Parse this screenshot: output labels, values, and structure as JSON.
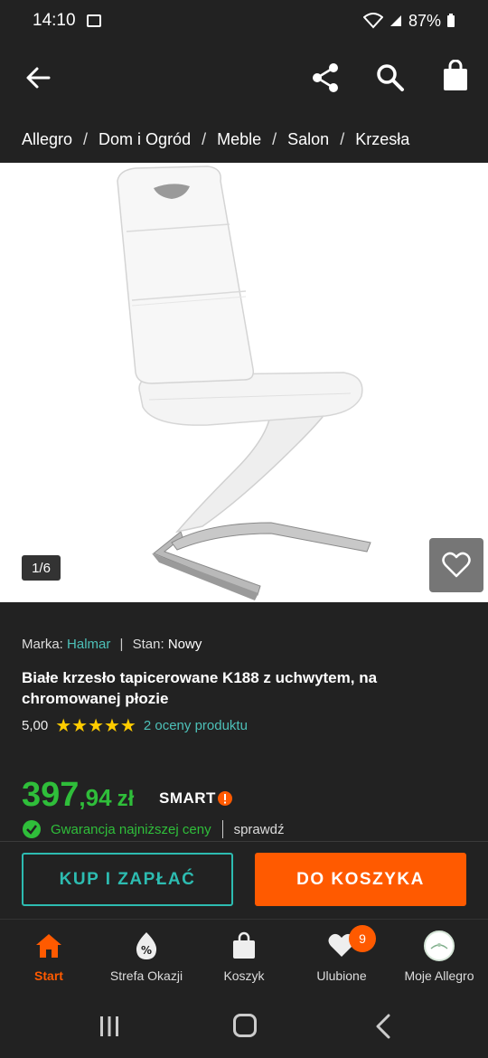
{
  "status_bar": {
    "time": "14:10",
    "battery": "87%"
  },
  "app_bar": {
    "icons": [
      "back-arrow-icon",
      "share-icon",
      "search-icon",
      "shopping-bag-icon"
    ]
  },
  "breadcrumb": [
    "Allegro",
    "Dom i Ogród",
    "Meble",
    "Salon",
    "Krzesła"
  ],
  "gallery": {
    "counter": "1/6"
  },
  "product": {
    "brand_label": "Marka:",
    "brand": "Halmar",
    "condition_label": "Stan:",
    "condition": "Nowy",
    "title": "Białe krzesło tapicerowane K188 z uchwytem, na chromowanej płozie",
    "rating_value": "5,00",
    "stars_text": "★★★★★",
    "rating_count": "2 oceny produktu",
    "price_main": "397",
    "price_cents": ",94",
    "price_currency": "zł",
    "smart_label": "SMART",
    "guarantee": "Gwarancja najniższej ceny",
    "check": "sprawdź"
  },
  "actions": {
    "buy_now": "KUP I ZAPŁAĆ",
    "add_to_cart": "DO KOSZYKA"
  },
  "bottom_nav": {
    "items": [
      {
        "label": "Start",
        "icon": "home-icon",
        "active": true
      },
      {
        "label": "Strefa Okazji",
        "icon": "deals-icon"
      },
      {
        "label": "Koszyk",
        "icon": "bag-icon"
      },
      {
        "label": "Ulubione",
        "icon": "heart-icon",
        "badge": "9"
      },
      {
        "label": "Moje Allegro",
        "icon": "avatar"
      }
    ]
  },
  "colors": {
    "background": "#222222",
    "accent_orange": "#ff5a00",
    "teal": "#2dbcb1",
    "price_green": "#2fbe3a",
    "star": "#ffcc00"
  }
}
